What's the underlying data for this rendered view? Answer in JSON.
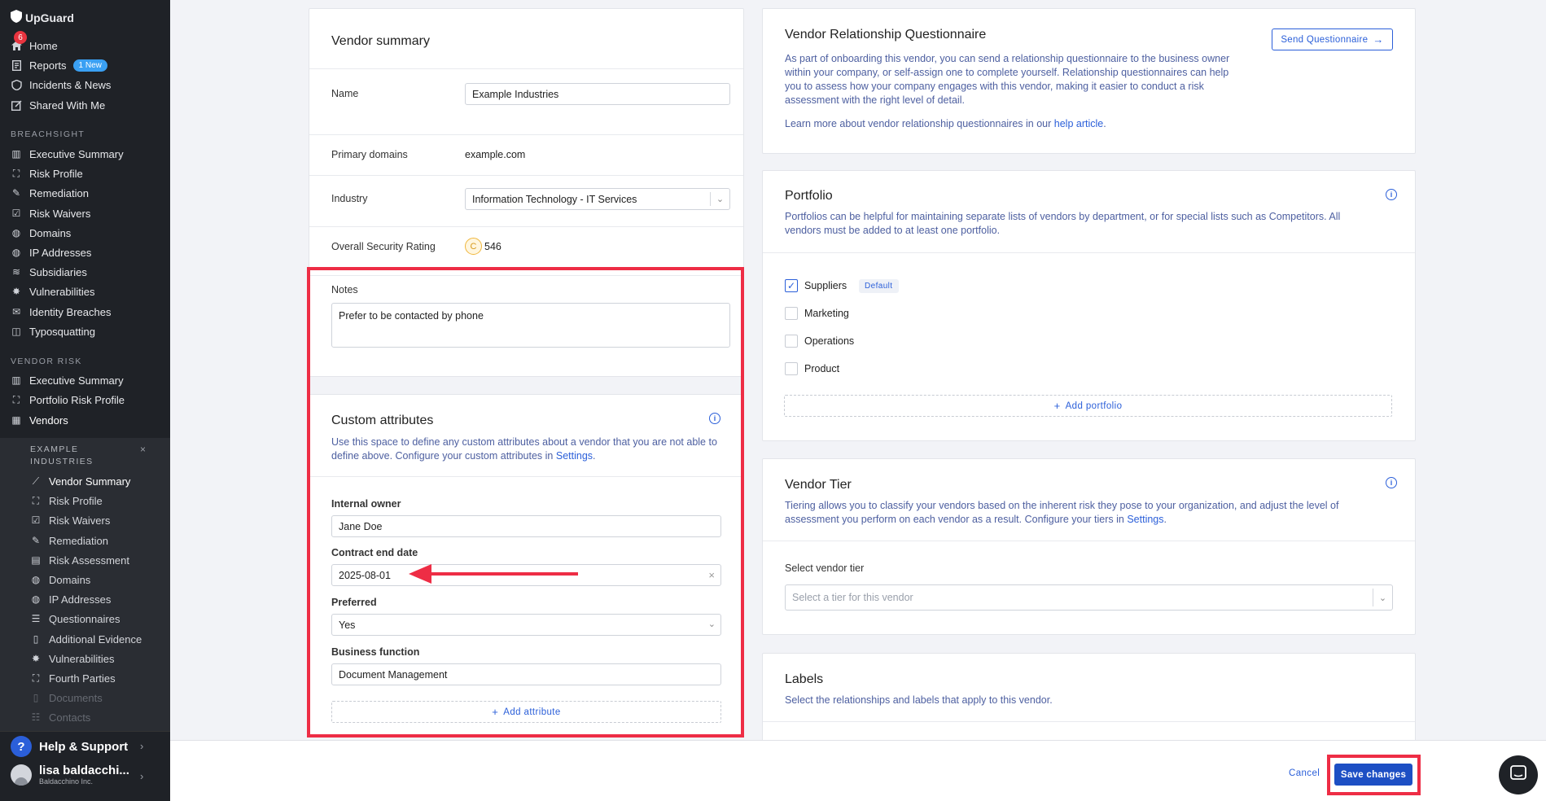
{
  "sidebar": {
    "brand": "UpGuard",
    "home_badge": "6",
    "top_items": [
      {
        "label": "Home"
      },
      {
        "label": "Reports",
        "badge": "1 New"
      },
      {
        "label": "Incidents & News"
      },
      {
        "label": "Shared With Me"
      }
    ],
    "breachsight_title": "BREACHSIGHT",
    "breachsight_items": [
      {
        "label": "Executive Summary"
      },
      {
        "label": "Risk Profile"
      },
      {
        "label": "Remediation"
      },
      {
        "label": "Risk Waivers"
      },
      {
        "label": "Domains"
      },
      {
        "label": "IP Addresses"
      },
      {
        "label": "Subsidiaries"
      },
      {
        "label": "Vulnerabilities"
      },
      {
        "label": "Identity Breaches"
      },
      {
        "label": "Typosquatting"
      }
    ],
    "vendor_risk_title": "VENDOR RISK",
    "vendor_risk_items": [
      {
        "label": "Executive Summary"
      },
      {
        "label": "Portfolio Risk Profile"
      },
      {
        "label": "Vendors"
      }
    ],
    "vendor_context": {
      "name": "EXAMPLE INDUSTRIES",
      "close": "×",
      "items": [
        {
          "label": "Vendor Summary"
        },
        {
          "label": "Risk Profile"
        },
        {
          "label": "Risk Waivers"
        },
        {
          "label": "Remediation"
        },
        {
          "label": "Risk Assessment"
        },
        {
          "label": "Domains"
        },
        {
          "label": "IP Addresses"
        },
        {
          "label": "Questionnaires"
        },
        {
          "label": "Additional Evidence"
        },
        {
          "label": "Vulnerabilities"
        },
        {
          "label": "Fourth Parties"
        },
        {
          "label": "Documents"
        },
        {
          "label": "Contacts"
        }
      ]
    },
    "help_label": "Help & Support",
    "user_name": "lisa baldacchi...",
    "user_org": "Baldacchino Inc."
  },
  "summary": {
    "title": "Vendor summary",
    "name_label": "Name",
    "name_value": "Example Industries",
    "domains_label": "Primary domains",
    "domains_value": "example.com",
    "industry_label": "Industry",
    "industry_value": "Information Technology - IT Services",
    "rating_label": "Overall Security Rating",
    "rating_grade": "C",
    "rating_value": "546",
    "notes_label": "Notes",
    "notes_value": "Prefer to be contacted by phone"
  },
  "custom": {
    "title": "Custom attributes",
    "desc": "Use this space to define any custom attributes about a vendor that you are not able to define above. Configure your custom attributes in ",
    "settings_link": "Settings",
    "period": ".",
    "owner_label": "Internal owner",
    "owner_value": "Jane Doe",
    "contract_label": "Contract end date",
    "contract_value": "2025-08-01",
    "clear": "×",
    "preferred_label": "Preferred",
    "preferred_value": "Yes",
    "business_label": "Business function",
    "business_value": "Document Management",
    "add_attribute": "Add attribute"
  },
  "questionnaire": {
    "title": "Vendor Relationship Questionnaire",
    "send_button": "Send Questionnaire",
    "desc": "As part of onboarding this vendor, you can send a relationship questionnaire to the business owner within your company, or self-assign one to complete yourself. Relationship questionnaires can help you to assess how your company engages with this vendor, making it easier to conduct a risk assessment with the right level of detail.",
    "learn_more": "Learn more about vendor relationship questionnaires in our ",
    "help_link": "help article",
    "period": "."
  },
  "portfolio": {
    "title": "Portfolio",
    "desc": "Portfolios can be helpful for maintaining separate lists of vendors by department, or for special lists such as Competitors. All vendors must be added to at least one portfolio.",
    "items": [
      {
        "label": "Suppliers",
        "checked": true,
        "tag": "Default"
      },
      {
        "label": "Marketing",
        "checked": false
      },
      {
        "label": "Operations",
        "checked": false
      },
      {
        "label": "Product",
        "checked": false
      }
    ],
    "add_portfolio": "Add portfolio"
  },
  "tier": {
    "title": "Vendor Tier",
    "desc": "Tiering allows you to classify your vendors based on the inherent risk they pose to your organization, and adjust the level of assessment you perform on each vendor as a result. Configure your tiers in ",
    "settings_link": "Settings",
    "period": ".",
    "select_label": "Select vendor tier",
    "select_placeholder": "Select a tier for this vendor"
  },
  "labels": {
    "title": "Labels",
    "desc": "Select the relationships and labels that apply to this vendor."
  },
  "footer": {
    "cancel": "Cancel",
    "save": "Save changes"
  },
  "colors": {
    "accent": "#2b5fd9",
    "highlight": "#ee2d45",
    "sidebar_bg": "#1f2227",
    "save_bg": "#1d4fc4"
  }
}
